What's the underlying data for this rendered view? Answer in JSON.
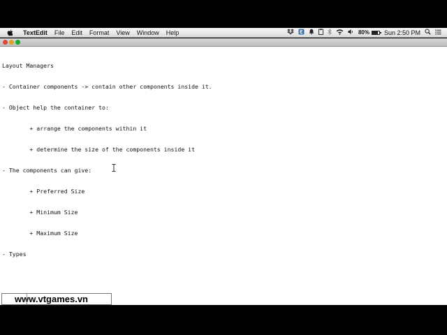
{
  "menubar": {
    "apple_icon": "apple-logo-icon",
    "app_name": "TextEdit",
    "items": [
      "File",
      "Edit",
      "Format",
      "View",
      "Window",
      "Help"
    ],
    "status": {
      "battery_percent": "80%",
      "battery_level": 0.8,
      "clock": "Sun 2:50 PM"
    }
  },
  "document": {
    "lines": [
      "Layout Managers",
      "- Container components -> contain other components inside it.",
      "- Object help the container to:",
      "        + arrange the components within it",
      "        + determine the size of the components inside it",
      "- The components can give:",
      "        + Preferred Size",
      "        + Minimum Size",
      "        + Maximum Size",
      "- Types"
    ]
  },
  "watermark": {
    "text": "www.vtgames.vn"
  }
}
